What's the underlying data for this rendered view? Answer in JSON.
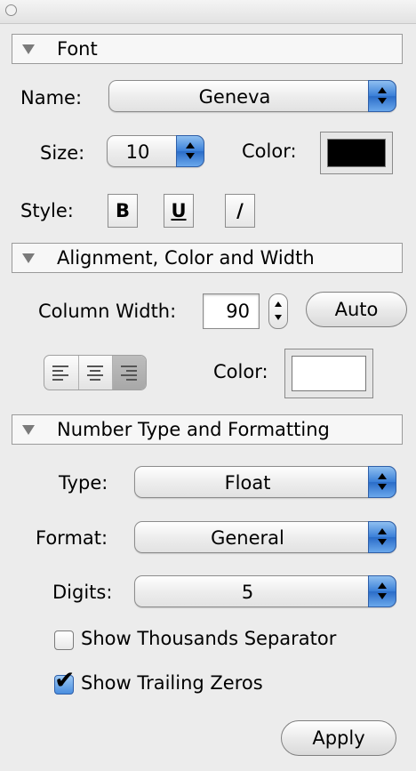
{
  "font": {
    "header": "Font",
    "name_label": "Name:",
    "name_value": "Geneva",
    "size_label": "Size:",
    "size_value": "10",
    "color_label": "Color:",
    "color_swatch": "#000000",
    "style_label": "Style:",
    "bold_label": "B",
    "underline_label": "U",
    "italic_label": "/"
  },
  "alignment": {
    "header": "Alignment, Color and Width",
    "column_width_label": "Column Width:",
    "column_width_value": "90",
    "auto_button": "Auto",
    "align_options": [
      "left",
      "center",
      "right"
    ],
    "align_selected": "right",
    "color_label": "Color:",
    "color_swatch": "#ffffff"
  },
  "number": {
    "header": "Number Type and Formatting",
    "type_label": "Type:",
    "type_value": "Float",
    "format_label": "Format:",
    "format_value": "General",
    "digits_label": "Digits:",
    "digits_value": "5",
    "thousands_label": "Show Thousands Separator",
    "thousands_checked": false,
    "trailing_label": "Show Trailing Zeros",
    "trailing_checked": true
  },
  "apply_button": "Apply",
  "colors": {
    "panel_bg": "#ececec",
    "accent_blue": "#3a7fd8"
  }
}
